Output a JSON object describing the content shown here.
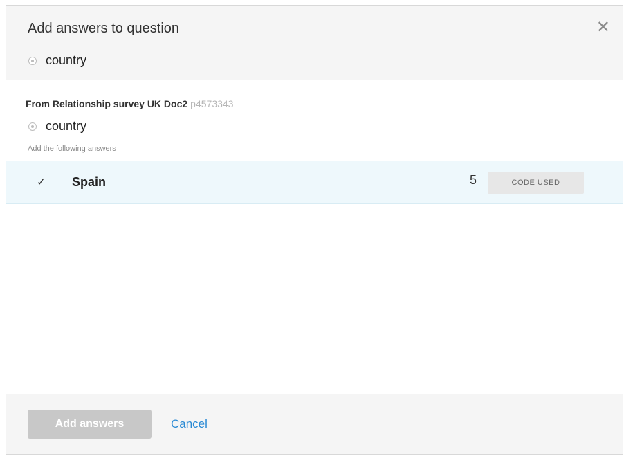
{
  "dialog": {
    "title": "Add answers to question",
    "close_glyph": "✕",
    "target_question": "country"
  },
  "source": {
    "prefix": "From Relationship survey UK Doc2",
    "project_id": "p4573343",
    "question": "country",
    "instruction": "Add the following answers"
  },
  "answers": [
    {
      "checked_glyph": "✓",
      "label": "Spain",
      "count": "5",
      "status": "CODE USED"
    }
  ],
  "footer": {
    "add_label": "Add answers",
    "cancel_label": "Cancel"
  },
  "colors": {
    "accent_link": "#2a8ad4",
    "row_highlight": "#eef8fc",
    "button_disabled": "#c8c8c8"
  }
}
